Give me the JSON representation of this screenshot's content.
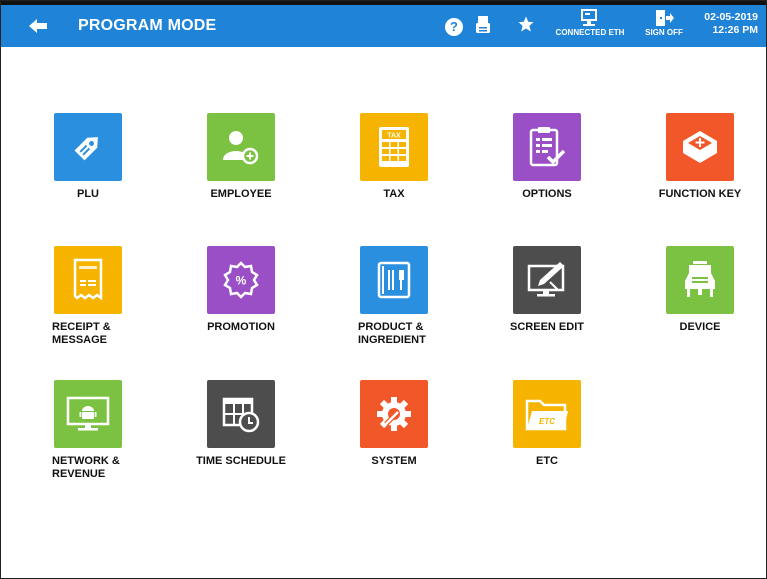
{
  "header": {
    "title": "PROGRAM MODE",
    "help_icon": "help-icon",
    "connection_label": "CONNECTED ETH",
    "signoff_label": "SIGN OFF",
    "date": "02-05-2019",
    "time": "12:26 PM",
    "bar_color": "#1f83d8"
  },
  "tiles": [
    {
      "label": "PLU",
      "icon": "price-tag-icon",
      "color": "#2b8fe0"
    },
    {
      "label": "EMPLOYEE",
      "icon": "add-user-icon",
      "color": "#7cc242"
    },
    {
      "label": "TAX",
      "icon": "tax-calculator-icon",
      "color": "#f6b400"
    },
    {
      "label": "OPTIONS",
      "icon": "clipboard-check-icon",
      "color": "#9b4fc6"
    },
    {
      "label": "FUNCTION KEY",
      "icon": "key-icon",
      "color": "#f2572a"
    },
    {
      "label": "RECEIPT &\nMESSAGE",
      "icon": "receipt-icon",
      "color": "#f6b400"
    },
    {
      "label": "PROMOTION",
      "icon": "discount-badge-icon",
      "color": "#9b4fc6"
    },
    {
      "label": "PRODUCT &\nINGREDIENT",
      "icon": "menu-book-icon",
      "color": "#2b8fe0"
    },
    {
      "label": "SCREEN EDIT",
      "icon": "monitor-edit-icon",
      "color": "#4d4d4d"
    },
    {
      "label": "DEVICE",
      "icon": "device-icon",
      "color": "#7cc242"
    },
    {
      "label": "NETWORK &\nREVENUE",
      "icon": "android-monitor-icon",
      "color": "#7cc242"
    },
    {
      "label": "TIME SCHEDULE",
      "icon": "calendar-clock-icon",
      "color": "#4d4d4d"
    },
    {
      "label": "SYSTEM",
      "icon": "gear-wrench-icon",
      "color": "#f2572a"
    },
    {
      "label": "ETC",
      "icon": "folder-icon",
      "color": "#f6b400",
      "folder_text": "ETC"
    }
  ]
}
